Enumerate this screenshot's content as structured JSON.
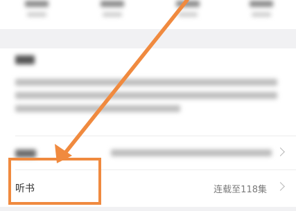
{
  "details": {
    "listen_book_label": "听书",
    "listen_book_status": "连载至118集"
  },
  "colors": {
    "annotation_orange": "#f08a3f",
    "page_background": "#f1f1f3",
    "card_background": "#ffffff"
  },
  "icons": {
    "chevron": "chevron-right-icon",
    "annotation": "arrow-annotation-icon"
  }
}
